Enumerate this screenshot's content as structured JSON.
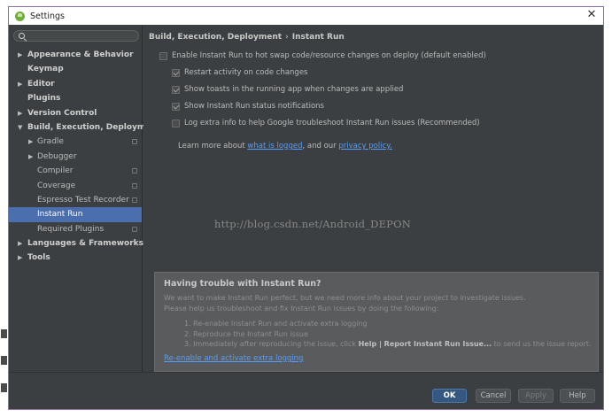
{
  "window": {
    "title": "Settings",
    "close_glyph": "✕"
  },
  "search": {
    "placeholder": "",
    "value": ""
  },
  "sidebar": {
    "items": [
      {
        "label": "Appearance & Behavior",
        "arrow": "▶",
        "level": 0,
        "bold": true,
        "copy": false,
        "selected": false
      },
      {
        "label": "Keymap",
        "arrow": "",
        "level": 0,
        "bold": true,
        "copy": false,
        "selected": false
      },
      {
        "label": "Editor",
        "arrow": "▶",
        "level": 0,
        "bold": true,
        "copy": false,
        "selected": false
      },
      {
        "label": "Plugins",
        "arrow": "",
        "level": 0,
        "bold": true,
        "copy": false,
        "selected": false
      },
      {
        "label": "Version Control",
        "arrow": "▶",
        "level": 0,
        "bold": true,
        "copy": false,
        "selected": false
      },
      {
        "label": "Build, Execution, Deployment",
        "arrow": "▼",
        "level": 0,
        "bold": true,
        "copy": false,
        "selected": false
      },
      {
        "label": "Gradle",
        "arrow": "▶",
        "level": 1,
        "bold": false,
        "copy": true,
        "selected": false
      },
      {
        "label": "Debugger",
        "arrow": "▶",
        "level": 1,
        "bold": false,
        "copy": false,
        "selected": false
      },
      {
        "label": "Compiler",
        "arrow": "",
        "level": 1,
        "bold": false,
        "copy": true,
        "selected": false
      },
      {
        "label": "Coverage",
        "arrow": "",
        "level": 1,
        "bold": false,
        "copy": true,
        "selected": false
      },
      {
        "label": "Espresso Test Recorder",
        "arrow": "",
        "level": 1,
        "bold": false,
        "copy": true,
        "selected": false
      },
      {
        "label": "Instant Run",
        "arrow": "",
        "level": 1,
        "bold": false,
        "copy": false,
        "selected": true
      },
      {
        "label": "Required Plugins",
        "arrow": "",
        "level": 1,
        "bold": false,
        "copy": true,
        "selected": false
      },
      {
        "label": "Languages & Frameworks",
        "arrow": "▶",
        "level": 0,
        "bold": true,
        "copy": false,
        "selected": false
      },
      {
        "label": "Tools",
        "arrow": "▶",
        "level": 0,
        "bold": true,
        "copy": false,
        "selected": false
      }
    ]
  },
  "breadcrumb": {
    "parent": "Build, Execution, Deployment",
    "separator": "›",
    "current": "Instant Run"
  },
  "options": {
    "enable": {
      "label": "Enable Instant Run to hot swap code/resource changes on deploy (default enabled)",
      "checked": false
    },
    "restart": {
      "label": "Restart activity on code changes",
      "checked": true
    },
    "toasts": {
      "label": "Show toasts in the running app when changes are applied",
      "checked": true
    },
    "notifications": {
      "label": "Show Instant Run status notifications",
      "checked": true
    },
    "logging": {
      "label": "Log extra info to help Google troubleshoot Instant Run issues (Recommended)",
      "checked": false
    }
  },
  "learn_more": {
    "prefix": "Learn more about ",
    "link1": "what is logged",
    "middle": ", and our ",
    "link2": "privacy policy."
  },
  "watermark": "http://blog.csdn.net/Android_DEPON",
  "trouble": {
    "heading": "Having trouble with Instant Run?",
    "desc1": "We want to make Instant Run perfect, but we need more info about your project to investigate issues.",
    "desc2": "Please help us troubleshoot and fix Instant Run issues by doing the following:",
    "step1": "1. Re-enable Instant Run and activate extra logging",
    "step2": "2. Reproduce the Instant Run issue",
    "step3_prefix": "3. Immediately after reproducing the issue, click ",
    "step3_bold": "Help | Report Instant Run Issue...",
    "step3_suffix": " to send us the issue report.",
    "link": "Re-enable and activate extra logging"
  },
  "buttons": {
    "ok": "OK",
    "cancel": "Cancel",
    "apply": "Apply",
    "help": "Help"
  },
  "colors": {
    "background": "#3c3f41",
    "selection": "#4b6eaf",
    "link": "#589df6",
    "primary_button": "#365880"
  }
}
